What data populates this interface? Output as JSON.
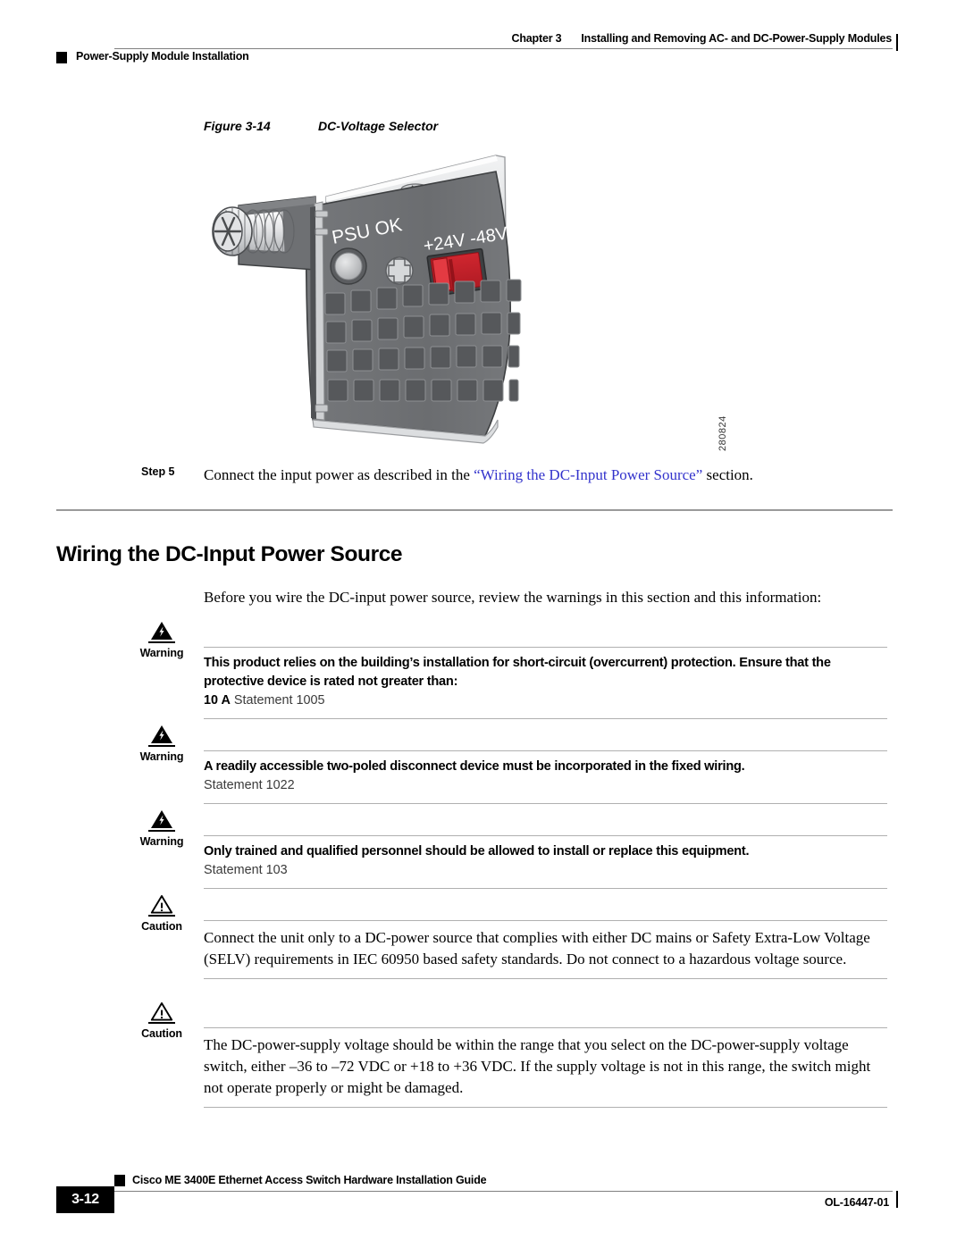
{
  "header": {
    "chapter_label": "Chapter 3",
    "chapter_title": "Installing and Removing AC- and DC-Power-Supply Modules",
    "section_title": "Power-Supply Module Installation"
  },
  "figure": {
    "label": "Figure 3-14",
    "title": "DC-Voltage Selector",
    "art_id": "280824",
    "callouts": {
      "psu_ok": "PSU OK",
      "voltage_left": "+24V",
      "voltage_right": "-48V"
    },
    "colors": {
      "faceplate": "#6e7073",
      "faceplate_dark": "#5a5c5f",
      "vent": "#56585b",
      "switch_red": "#c0202a",
      "switch_red_light": "#e03038",
      "metal_light": "#e9eaec",
      "metal_mid": "#c3c5c8",
      "outline": "#3a3c3e"
    }
  },
  "step": {
    "label": "Step 5",
    "text_before": "Connect the input power as described in the ",
    "link_text": "“Wiring the DC-Input Power Source”",
    "text_after": " section.",
    "link_color": "#3333cc"
  },
  "heading": {
    "title": "Wiring the DC-Input Power Source"
  },
  "intro": {
    "text": "Before you wire the DC-input power source, review the warnings in this section and this information:"
  },
  "admonitions": [
    {
      "kind": "Warning",
      "icon": "warning-lightning-triangle-icon",
      "body_bold": "This product relies on the building’s installation for short-circuit (overcurrent) protection. Ensure that the protective device is rated not greater than:",
      "body_value": "10 A",
      "body_statement": "Statement 1005"
    },
    {
      "kind": "Warning",
      "icon": "warning-lightning-triangle-icon",
      "body_bold": "A readily accessible two-poled disconnect device must be incorporated in the fixed wiring.",
      "body_value": "",
      "body_statement": "Statement 1022"
    },
    {
      "kind": "Warning",
      "icon": "warning-lightning-triangle-icon",
      "body_bold": "Only trained and qualified personnel should be allowed to install or replace this equipment.",
      "body_value": "",
      "body_statement": "Statement 103"
    },
    {
      "kind": "Caution",
      "icon": "caution-exclamation-triangle-icon",
      "body_text": "Connect the unit only to a DC-power source that complies with either DC mains or Safety Extra-Low Voltage (SELV) requirements in IEC 60950 based safety standards. Do not connect to a hazardous voltage source."
    },
    {
      "kind": "Caution",
      "icon": "caution-exclamation-triangle-icon",
      "body_text": "The DC-power-supply voltage should be within the range that you select on the DC-power-supply voltage switch, either –36 to –72 VDC or +18 to +36 VDC. If the supply voltage is not in this range, the switch might not operate properly or might be damaged."
    }
  ],
  "footer": {
    "doc_title": "Cisco ME 3400E Ethernet Access Switch Hardware Installation Guide",
    "page_number": "3-12",
    "doc_number": "OL-16447-01"
  }
}
